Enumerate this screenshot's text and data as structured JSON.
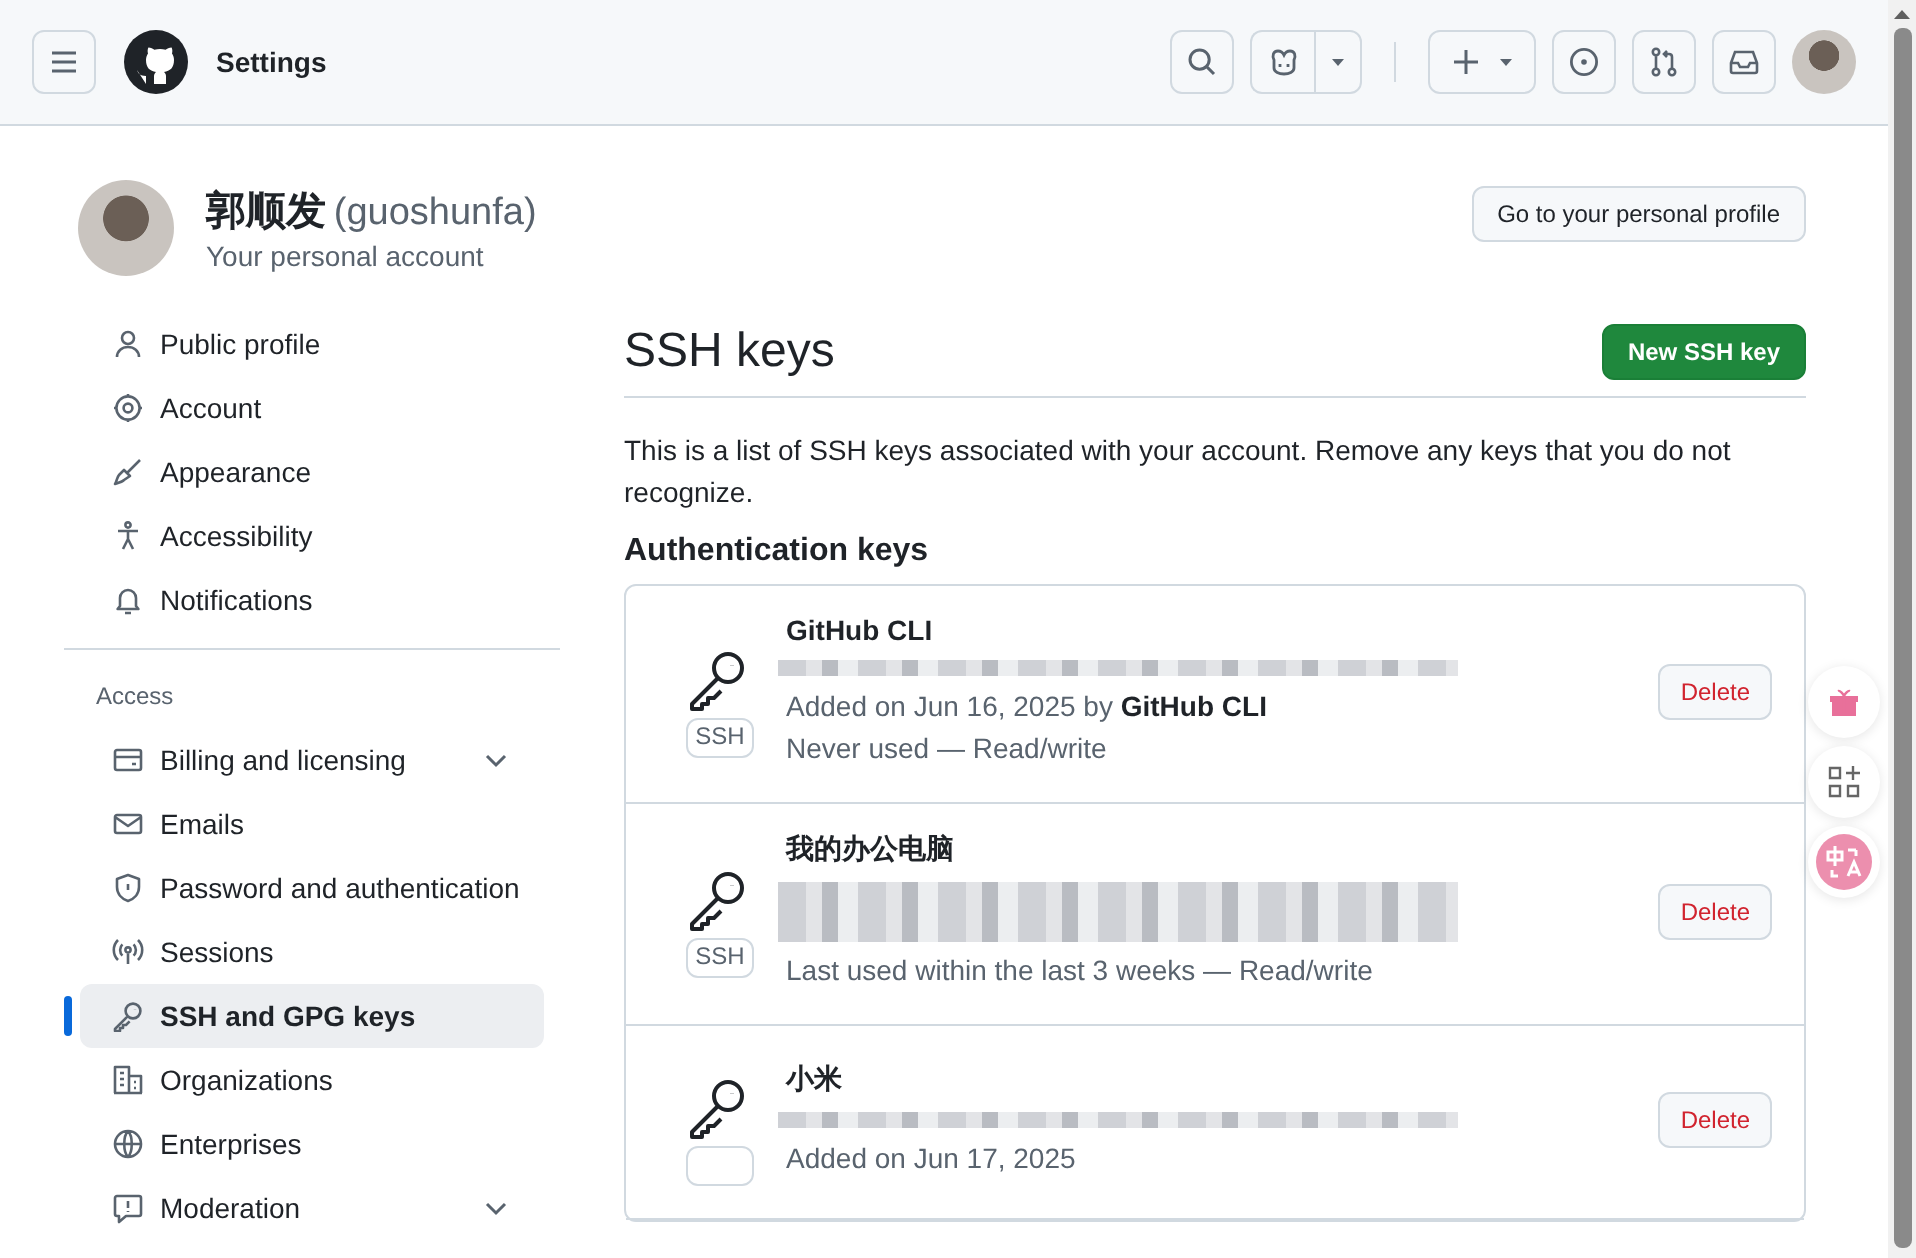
{
  "header": {
    "title": "Settings"
  },
  "profile": {
    "name": "郭顺发",
    "login": "(guoshunfa)",
    "subtitle": "Your personal account",
    "button": "Go to your personal profile"
  },
  "sidebar": {
    "groups": [
      {
        "items": [
          {
            "label": "Public profile",
            "selected": false,
            "expandable": false
          },
          {
            "label": "Account",
            "selected": false,
            "expandable": false
          },
          {
            "label": "Appearance",
            "selected": false,
            "expandable": false
          },
          {
            "label": "Accessibility",
            "selected": false,
            "expandable": false
          },
          {
            "label": "Notifications",
            "selected": false,
            "expandable": false
          }
        ]
      },
      {
        "heading": "Access",
        "items": [
          {
            "label": "Billing and licensing",
            "selected": false,
            "expandable": true
          },
          {
            "label": "Emails",
            "selected": false,
            "expandable": false
          },
          {
            "label": "Password and authentication",
            "selected": false,
            "expandable": false
          },
          {
            "label": "Sessions",
            "selected": false,
            "expandable": false
          },
          {
            "label": "SSH and GPG keys",
            "selected": true,
            "expandable": false
          },
          {
            "label": "Organizations",
            "selected": false,
            "expandable": false
          },
          {
            "label": "Enterprises",
            "selected": false,
            "expandable": false
          },
          {
            "label": "Moderation",
            "selected": false,
            "expandable": true
          }
        ]
      }
    ]
  },
  "content": {
    "title": "SSH keys",
    "new_button": "New SSH key",
    "description": "This is a list of SSH keys associated with your account. Remove any keys that you do not recognize.",
    "section": "Authentication keys",
    "keys": [
      {
        "title": "GitHub CLI",
        "badge": "SSH",
        "lines": [
          "Added on Jun 16, 2025 by **GitHub CLI**",
          "Never used — Read/write"
        ],
        "delete": "Delete"
      },
      {
        "title": "我的办公电脑",
        "badge": "SSH",
        "lines": [
          "Last used within the last 3 weeks — Read/write"
        ],
        "delete": "Delete"
      },
      {
        "title": "小米",
        "lines": [
          "Added on Jun 17, 2025"
        ],
        "delete": "Delete"
      }
    ]
  }
}
